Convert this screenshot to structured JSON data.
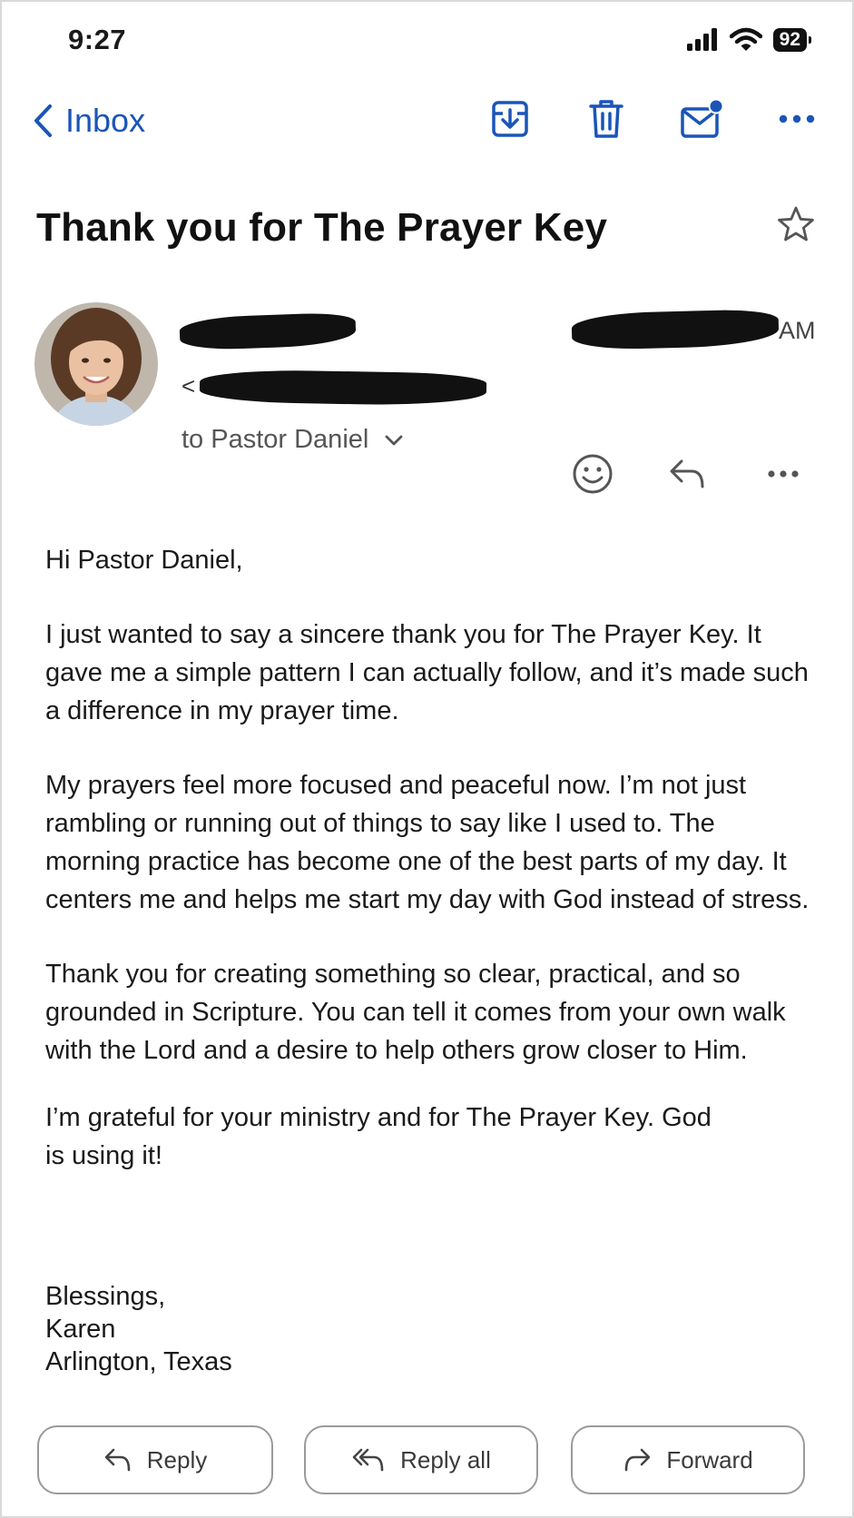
{
  "status_bar": {
    "time": "9:27",
    "battery": "92"
  },
  "nav": {
    "back_label": "Inbox"
  },
  "email": {
    "subject": "Thank you for The Prayer Key",
    "sender_email_open": "<",
    "sender_email_close": ">",
    "time_suffix": "AM",
    "recipient": "to Pastor Daniel",
    "body": [
      "Hi Pastor Daniel,",
      "I just wanted to say a sincere thank you for The Prayer Key. It gave me a simple pattern I can actually follow, and it’s made such a difference in my prayer time.",
      "My prayers feel more focused and peaceful now. I’m not just rambling or running out of things to say like I used to. The morning practice has become one of the best parts of my day. It centers me and helps me start my day with God instead of stress.",
      "Thank you for creating something so clear, practical, and so grounded in Scripture. You can tell it comes from your own walk with the Lord and a desire to help others grow closer to Him.",
      "I’m grateful for your ministry and for The Prayer Key. God is using it!"
    ],
    "signature": [
      "Blessings,",
      "Karen",
      "Arlington, Texas"
    ]
  },
  "actions": {
    "reply": "Reply",
    "reply_all": "Reply all",
    "forward": "Forward"
  },
  "colors": {
    "accent": "#1a55b8",
    "notification_dot": "#1a55b8",
    "text": "#1a1a1a"
  },
  "icons": [
    "archive-icon",
    "trash-icon",
    "mail-unread-icon",
    "more-icon",
    "star-icon",
    "emoji-icon",
    "reply-icon",
    "reply-all-icon",
    "forward-icon",
    "chevron-left-icon",
    "chevron-down-icon"
  ]
}
